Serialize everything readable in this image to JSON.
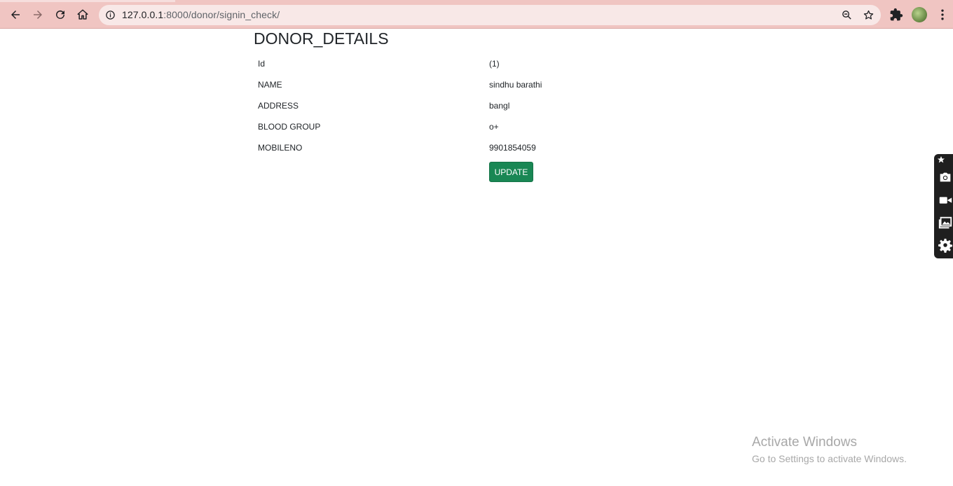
{
  "browser": {
    "url_host": "127.0.0.1",
    "url_rest": ":8000/donor/signin_check/",
    "icons": [
      "back-arrow-icon",
      "forward-arrow-icon",
      "reload-icon",
      "home-icon",
      "site-info-icon",
      "zoom-icon",
      "star-icon",
      "puzzle-icon",
      "profile-avatar",
      "kebab-menu-icon"
    ]
  },
  "page": {
    "title": "DONOR_DETAILS",
    "rows": [
      {
        "label": "Id",
        "value": "(1)"
      },
      {
        "label": "NAME",
        "value": "sindhu barathi"
      },
      {
        "label": "ADDRESS",
        "value": "bangl"
      },
      {
        "label": "BLOOD GROUP",
        "value": "o+"
      },
      {
        "label": "MOBILENO",
        "value": "9901854059"
      }
    ],
    "update_label": "UPDATE",
    "colors": {
      "button": "#198754"
    }
  },
  "side_widget": {
    "icons": [
      "pin-icon",
      "camera-icon",
      "video-icon",
      "gallery-icon",
      "settings-gear-icon"
    ]
  },
  "watermark": {
    "line1": "Activate Windows",
    "line2": "Go to Settings to activate Windows."
  }
}
